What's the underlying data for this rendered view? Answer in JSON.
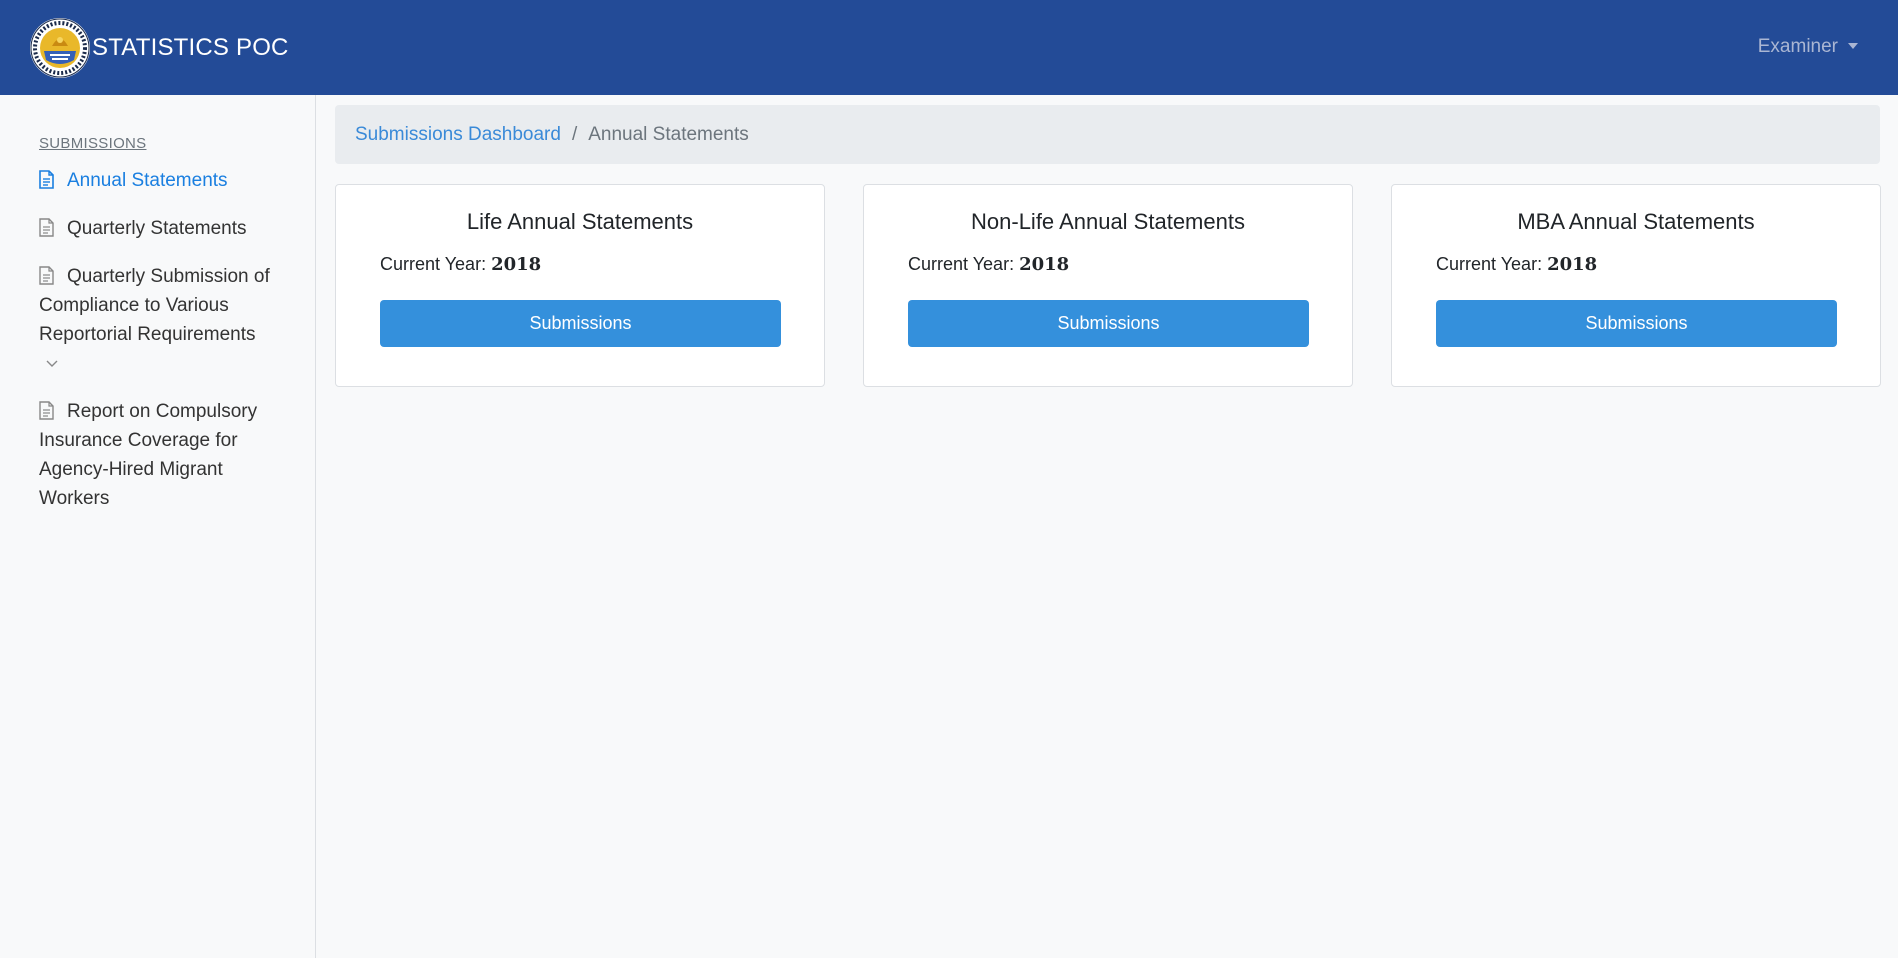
{
  "header": {
    "brand_title": "STATISTICS POC",
    "user_label": "Examiner",
    "bg_color": "#234b97"
  },
  "sidebar": {
    "heading": "SUBMISSIONS",
    "items": [
      {
        "label": "Annual Statements",
        "active": true,
        "icon": "document-icon"
      },
      {
        "label": "Quarterly Statements",
        "active": false,
        "icon": "document-icon"
      },
      {
        "label": "Quarterly Submission of Compliance to Various Reportorial Requirements",
        "active": false,
        "icon": "document-icon",
        "has_submenu": true
      },
      {
        "label": "Report on Compulsory Insurance Coverage for Agency-Hired Migrant Workers",
        "active": false,
        "icon": "document-icon"
      }
    ]
  },
  "breadcrumb": {
    "link": "Submissions Dashboard",
    "separator": "/",
    "current": "Annual Statements"
  },
  "cards": [
    {
      "title": "Life Annual Statements",
      "year_label": "Current Year:",
      "year": "2018",
      "button": "Submissions"
    },
    {
      "title": "Non-Life Annual Statements",
      "year_label": "Current Year:",
      "year": "2018",
      "button": "Submissions"
    },
    {
      "title": "MBA Annual Statements",
      "year_label": "Current Year:",
      "year": "2018",
      "button": "Submissions"
    }
  ],
  "colors": {
    "accent": "#3490dc",
    "active_link": "#1a7fe0"
  }
}
